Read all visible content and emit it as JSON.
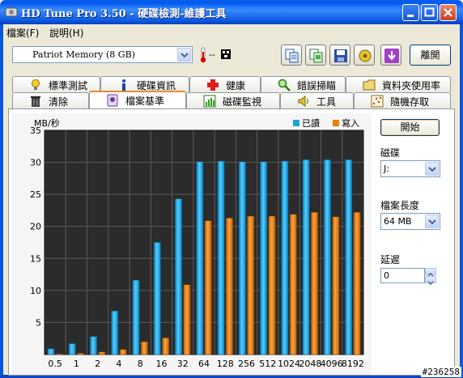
{
  "window": {
    "title": "HD Tune Pro 3.50 - 硬碟檢測-維護工具"
  },
  "menu": {
    "items": [
      {
        "label": "檔案(F)"
      },
      {
        "label": "說明(H)"
      }
    ]
  },
  "toolbar": {
    "drive_value": "Patriot Memory (8 GB)",
    "temperature": "--",
    "exit_label": "離開",
    "icons": [
      "copy-info-icon",
      "copy-screen-icon",
      "save-icon",
      "options-icon",
      "down-arrow-icon"
    ]
  },
  "tabs": {
    "row1": [
      {
        "label": "標準測試",
        "icon": "lightbulb-icon"
      },
      {
        "label": "硬碟資訊",
        "icon": "info-icon"
      },
      {
        "label": "健康",
        "icon": "health-cross-icon"
      },
      {
        "label": "錯誤掃瞄",
        "icon": "magnifier-icon"
      },
      {
        "label": "資料夾使用率",
        "icon": "folder-icon"
      }
    ],
    "row2": [
      {
        "label": "清除",
        "icon": "trash-icon"
      },
      {
        "label": "檔案基準",
        "icon": "file-benchmark-icon",
        "active": true
      },
      {
        "label": "磁碟監視",
        "icon": "monitor-icon"
      },
      {
        "label": "工具",
        "icon": "speaker-icon"
      },
      {
        "label": "隨機存取",
        "icon": "random-access-icon"
      }
    ]
  },
  "chart_data": {
    "type": "bar",
    "ylabel": "MB/秒",
    "ylim": [
      0,
      35
    ],
    "yticks": [
      5,
      10,
      15,
      20,
      25,
      30,
      35
    ],
    "categories": [
      "0.5",
      "1",
      "2",
      "4",
      "8",
      "16",
      "32",
      "64",
      "128",
      "256",
      "512",
      "1024",
      "2048",
      "4096",
      "8192"
    ],
    "series": [
      {
        "name": "已讀",
        "color": "#1fa3e0",
        "values": [
          0.9,
          1.7,
          2.8,
          6.8,
          11.6,
          17.5,
          24.3,
          30.1,
          30.2,
          30.1,
          30.1,
          30.2,
          30.4,
          30.4,
          30.4
        ]
      },
      {
        "name": "寫入",
        "color": "#e8820e",
        "values": [
          0.1,
          0.2,
          0.4,
          0.8,
          2.0,
          2.6,
          10.9,
          20.9,
          21.3,
          21.6,
          21.6,
          21.9,
          22.2,
          21.5,
          22.2
        ]
      }
    ],
    "grid": true,
    "legend": "top-right",
    "background": "#2b2b2b"
  },
  "settings": {
    "start_label": "開始",
    "disk_label": "磁碟",
    "disk_value": "J:",
    "file_length_label": "檔案長度",
    "file_length_value": "64 MB",
    "delay_label": "延遲",
    "delay_value": "0"
  },
  "watermark": "#236258"
}
